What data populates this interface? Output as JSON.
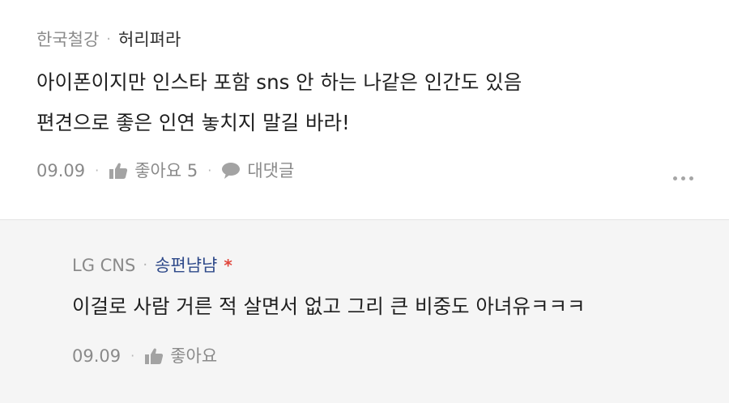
{
  "comments": [
    {
      "company": "한국철강",
      "nickname": "허리펴라",
      "lines": [
        "아이폰이지만 인스타 포함 sns 안 하는 나같은 인간도 있음",
        "편견으로 좋은 인연 놓치지 말길 바라!"
      ],
      "date": "09.09",
      "like_label": "좋아요 5",
      "reply_label": "대댓글"
    },
    {
      "company": "LG CNS",
      "nickname": "송편냠냠",
      "author_mark": "*",
      "lines": [
        "이걸로 사람 거른 적 살면서 없고 그리 큰 비중도 아녀유ㅋㅋㅋ"
      ],
      "date": "09.09",
      "like_label": "좋아요"
    }
  ],
  "separator": "·",
  "colors": {
    "reply_background": "#f5f5f5",
    "author_mark": "#e0463c",
    "reply_nickname": "#2f4a8a"
  },
  "icons": [
    "thumbs-up-icon",
    "speech-bubble-icon",
    "more-options-icon"
  ]
}
